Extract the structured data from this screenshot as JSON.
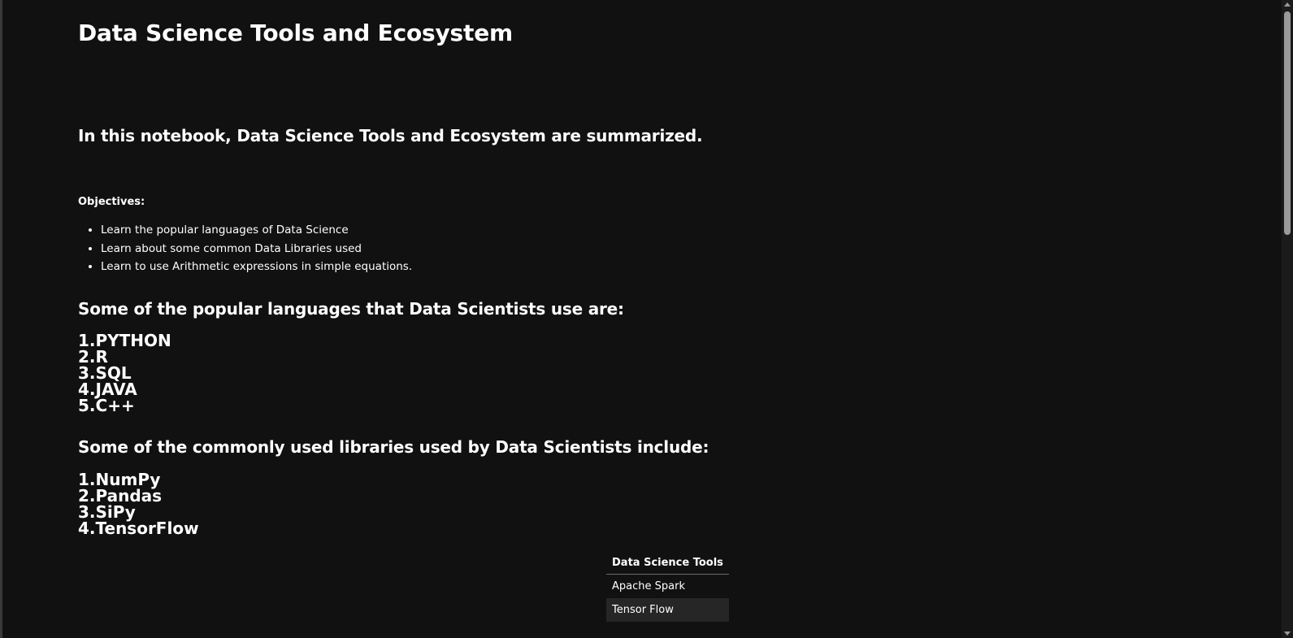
{
  "notebook": {
    "title": "Data Science Tools and Ecosystem",
    "intro": "In this notebook, Data Science Tools and Ecosystem are summarized.",
    "objectives": {
      "heading": "Objectives:",
      "items": [
        "Learn the popular languages of Data Science",
        "Learn about some common Data Libraries used",
        "Learn to use Arithmetic expressions in simple equations."
      ]
    },
    "languages": {
      "heading": "Some of the popular languages that Data Scientists use are:",
      "items": [
        "1.PYTHON",
        "2.R",
        "3.SQL",
        "4.JAVA",
        "5.C++"
      ]
    },
    "libraries": {
      "heading": "Some of the commonly used libraries used by Data Scientists include:",
      "items": [
        "1.NumPy",
        "2.Pandas",
        "3.SiPy",
        "4.TensorFlow"
      ]
    },
    "tools_table": {
      "header": "Data Science Tools",
      "rows": [
        "Apache Spark",
        "Tensor Flow"
      ]
    }
  },
  "colors": {
    "background": "#111111",
    "text": "#ffffff",
    "table_alt_row": "#262626",
    "scrollbar_thumb": "#9a9a9a"
  }
}
